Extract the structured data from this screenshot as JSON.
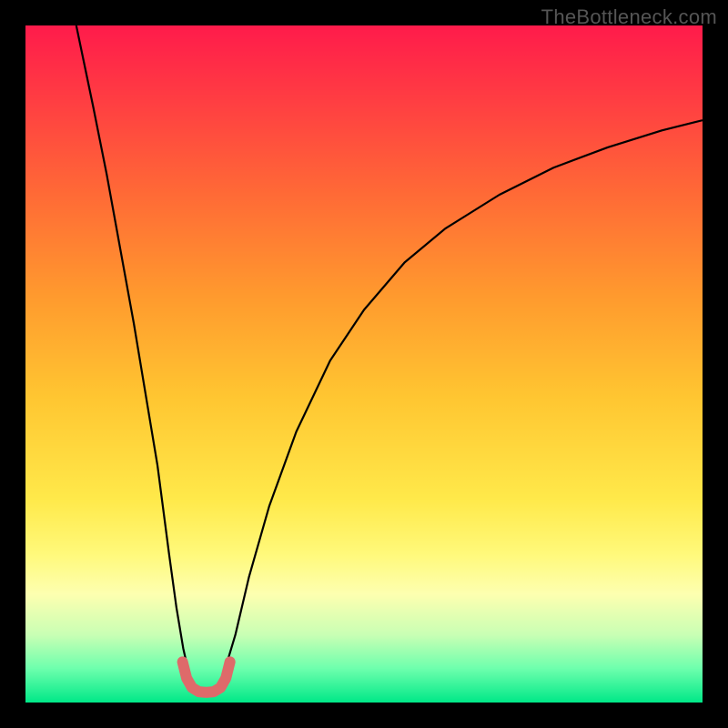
{
  "watermark": "TheBottleneck.com",
  "chart_data": {
    "type": "line",
    "title": "",
    "xlabel": "",
    "ylabel": "",
    "xlim": [
      0,
      100
    ],
    "ylim": [
      0,
      100
    ],
    "grid": false,
    "legend": false,
    "gradient_stops": [
      {
        "offset": 0.0,
        "color": "#ff1b4b"
      },
      {
        "offset": 0.1,
        "color": "#ff3a43"
      },
      {
        "offset": 0.25,
        "color": "#ff6a36"
      },
      {
        "offset": 0.4,
        "color": "#ff9a2e"
      },
      {
        "offset": 0.55,
        "color": "#ffc631"
      },
      {
        "offset": 0.7,
        "color": "#ffe94a"
      },
      {
        "offset": 0.78,
        "color": "#fff97a"
      },
      {
        "offset": 0.84,
        "color": "#fdffb0"
      },
      {
        "offset": 0.9,
        "color": "#c9ffb4"
      },
      {
        "offset": 0.95,
        "color": "#6dffad"
      },
      {
        "offset": 1.0,
        "color": "#00e888"
      }
    ],
    "series": [
      {
        "name": "left-branch",
        "color": "#000000",
        "width": 2.2,
        "x": [
          7.5,
          10,
          12,
          14,
          16,
          18,
          19.5,
          21.2,
          22.3,
          23.3,
          24.2,
          25.0
        ],
        "y": [
          100,
          88,
          78,
          67,
          56,
          44,
          35,
          22,
          14,
          8,
          4,
          2.5
        ]
      },
      {
        "name": "right-branch",
        "color": "#000000",
        "width": 2.2,
        "x": [
          28.5,
          29.5,
          31.0,
          33.0,
          36.0,
          40.0,
          45.0,
          50.0,
          56.0,
          62.0,
          70.0,
          78.0,
          86.0,
          94.0,
          100.0
        ],
        "y": [
          2.5,
          5.0,
          10.0,
          18.5,
          29.0,
          40.0,
          50.5,
          58.0,
          65.0,
          70.0,
          75.0,
          79.0,
          82.0,
          84.5,
          86.0
        ]
      },
      {
        "name": "valley-marker",
        "color": "#de6a6a",
        "width": 12,
        "linecap": "round",
        "x": [
          23.2,
          23.8,
          24.6,
          25.6,
          26.7,
          27.8,
          28.8,
          29.6,
          30.2
        ],
        "y": [
          6.0,
          3.6,
          2.2,
          1.6,
          1.5,
          1.6,
          2.2,
          3.6,
          6.0
        ]
      }
    ]
  }
}
